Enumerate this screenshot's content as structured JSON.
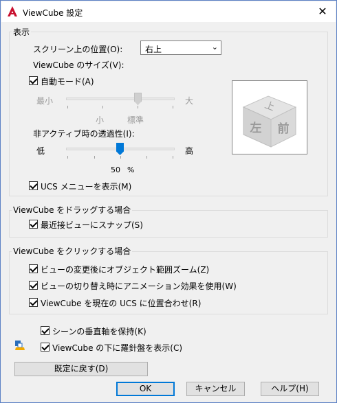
{
  "window": {
    "title": "ViewCube 設定",
    "close_label": "✕"
  },
  "display_group": {
    "title": "表示",
    "screen_position_label": "スクリーン上の位置(O):",
    "screen_position_value": "右上",
    "size_label": "ViewCube のサイズ(V):",
    "auto_mode_label": "自動モード(A)",
    "auto_mode_checked": true,
    "size_min_label": "最小",
    "size_max_label": "大",
    "size_small_label": "小",
    "size_standard_label": "標準",
    "inactive_opacity_label": "非アクティブ時の透過性(I):",
    "opacity_low_label": "低",
    "opacity_high_label": "高",
    "opacity_value": "50",
    "opacity_unit": "%",
    "opacity_percent": 50,
    "ucs_menu_label": "UCS メニューを表示(M)",
    "ucs_menu_checked": true,
    "cube_faces": {
      "top": "上",
      "left": "左",
      "front": "前"
    }
  },
  "drag_group": {
    "title": "ViewCube をドラッグする場合",
    "snap_label": "最近接ビューにスナップ(S)",
    "snap_checked": true
  },
  "click_group": {
    "title": "ViewCube をクリックする場合",
    "zoom_extents_label": "ビューの変更後にオブジェクト範囲ズーム(Z)",
    "animate_label": "ビューの切り替え時にアニメーション効果を使用(W)",
    "orient_ucs_label": "ViewCube を現在の UCS に位置合わせ(R)"
  },
  "keep_up_label": "シーンの垂直軸を保持(K)",
  "compass_label": "ViewCube の下に羅針盤を表示(C)",
  "restore_defaults_label": "既定に戻す(D)",
  "buttons": {
    "ok": "OK",
    "cancel": "キャンセル",
    "help": "ヘルプ(H)"
  },
  "colors": {
    "app_icon": "#c8102e",
    "slider_thumb": "#0078d7",
    "window_border": "#5a7fc4"
  }
}
